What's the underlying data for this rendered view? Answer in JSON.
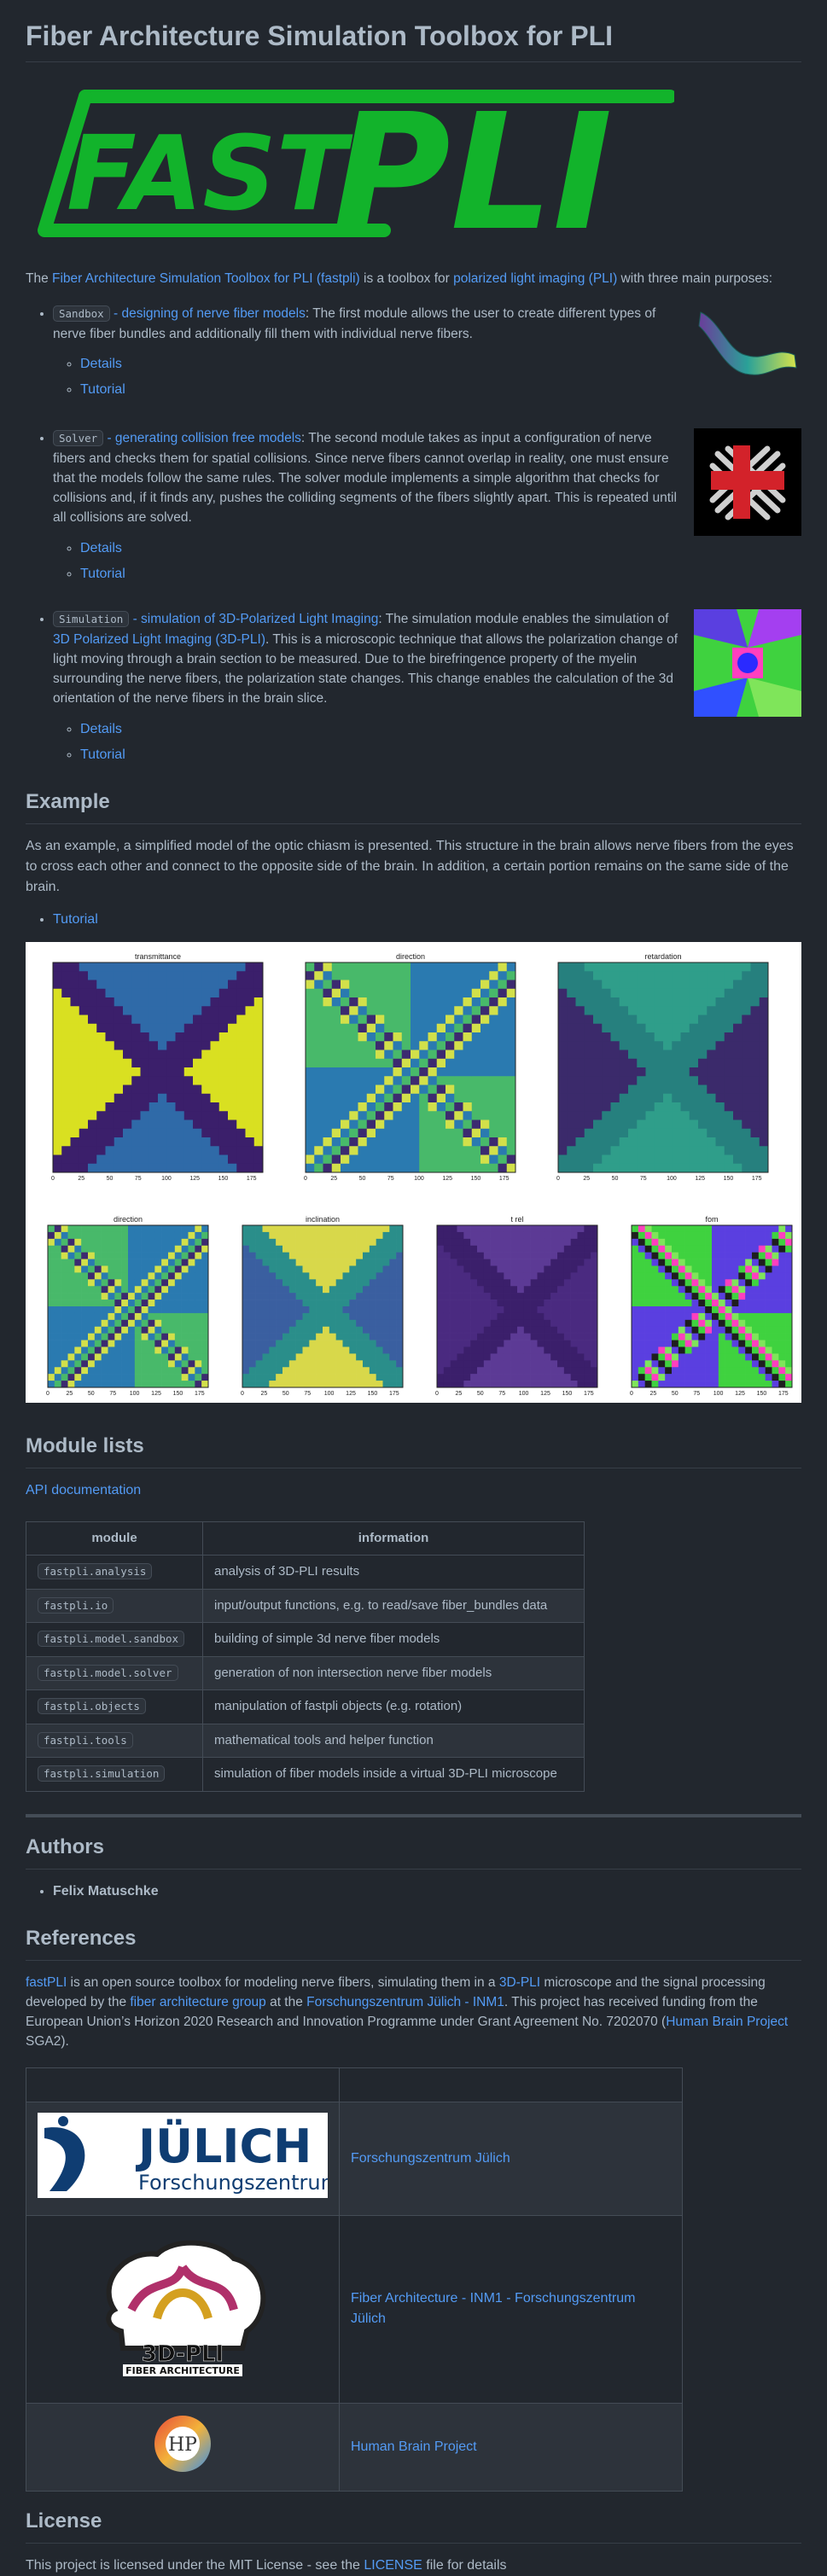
{
  "title": "Fiber Architecture Simulation Toolbox for PLI",
  "logo": {
    "text_fast": "FAST",
    "text_pli": "PLI",
    "color": "#12b32b"
  },
  "intro": {
    "lead": "The ",
    "link1": "Fiber Architecture Simulation Toolbox for PLI (fastpli)",
    "mid": " is a toolbox for ",
    "link2": "polarized light imaging (PLI)",
    "tail": " with three main purposes:"
  },
  "features": [
    {
      "badge": "Sandbox",
      "link": " - designing of nerve fiber models",
      "text": ": The first module allows the user to create different types of nerve fiber bundles and additionally fill them with individual nerve fibers.",
      "details": "Details",
      "tutorial": "Tutorial",
      "image_icon": "fiber-bundle-icon"
    },
    {
      "badge": "Solver",
      "link": " - generating collision free models",
      "text": ": The second module takes as input a configuration of nerve fibers and checks them for spatial collisions. Since nerve fibers cannot overlap in reality, one must ensure that the models follow the same rules. The solver module implements a simple algorithm that checks for collisions and, if it finds any, pushes the colliding segments of the fibers slightly apart. This is repeated until all collisions are solved.",
      "details": "Details",
      "tutorial": "Tutorial",
      "image_icon": "crossing-fibers-icon"
    },
    {
      "badge": "Simulation",
      "link": " - simulation of 3D-Polarized Light Imaging",
      "text_a": ": The simulation module enables the simulation of ",
      "link2": "3D Polarized Light Imaging (3D-PLI)",
      "text": ". This is a microscopic technique that allows the polarization change of light moving through a brain section to be measured. Due to the birefringence property of the myelin surrounding the nerve fibers, the polarization state changes. This change enables the calculation of the 3d orientation of the nerve fibers in the brain slice.",
      "details": "Details",
      "tutorial": "Tutorial",
      "image_icon": "fom-map-icon"
    }
  ],
  "example": {
    "heading": "Example",
    "text": "As an example, a simplified model of the optic chiasm is presented. This structure in the brain allows nerve fibers from the eyes to cross each other and connect to the opposite side of the brain. In addition, a certain portion remains on the same side of the brain.",
    "tutorial": "Tutorial",
    "row1_titles": [
      "transmittance",
      "direction",
      "retardation"
    ],
    "row2_titles": [
      "direction",
      "inclination",
      "t rel",
      "fom"
    ],
    "ticks": [
      "0",
      "25",
      "50",
      "75",
      "100",
      "125",
      "150",
      "175"
    ]
  },
  "modules": {
    "heading": "Module lists",
    "api": "API documentation",
    "col_module": "module",
    "col_info": "information",
    "rows": [
      {
        "module": "fastpli.analysis",
        "info": "analysis of 3D-PLI results"
      },
      {
        "module": "fastpli.io",
        "info": "input/output functions, e.g. to read/save fiber_bundles data"
      },
      {
        "module": "fastpli.model.sandbox",
        "info": "building of simple 3d nerve fiber models"
      },
      {
        "module": "fastpli.model.solver",
        "info": "generation of non intersection nerve fiber models"
      },
      {
        "module": "fastpli.objects",
        "info": "manipulation of fastpli objects (e.g. rotation)"
      },
      {
        "module": "fastpli.tools",
        "info": "mathematical tools and helper function"
      },
      {
        "module": "fastpli.simulation",
        "info": "simulation of fiber models inside a virtual 3D-PLI microscope"
      }
    ]
  },
  "authors": {
    "heading": "Authors",
    "name": "Felix Matuschke"
  },
  "references": {
    "heading": "References",
    "p_link1": "fastPLI",
    "p_a": " is an open source toolbox for modeling nerve fibers, simulating them in a ",
    "p_link2": "3D-PLI",
    "p_b": " microscope and the signal processing developed by the ",
    "p_link3": "fiber architecture group",
    "p_c": " at the ",
    "p_link4": "Forschungszentrum Jülich - INM1",
    "p_d": ". This project has received funding from the European Union’s Horizon 2020 Research and Innovation Programme under Grant Agreement No. 7202070 (",
    "p_link5": "Human Brain Project",
    "p_e": " SGA2).",
    "rows": [
      {
        "logo_top": "JÜLICH",
        "logo_bottom": "Forschungszentrum",
        "link": "Forschungszentrum Jülich"
      },
      {
        "logo_top": "3D-PLI",
        "logo_bottom": "FIBER ARCHITECTURE",
        "link": "Fiber Architecture - INM1 - Forschungszentrum Jülich"
      },
      {
        "logo_top": "HP",
        "logo_bottom": "",
        "link": "Human Brain Project"
      }
    ]
  },
  "license": {
    "heading": "License",
    "text_a": "This project is licensed under the MIT License - see the ",
    "link": "LICENSE",
    "text_b": " file for details"
  }
}
